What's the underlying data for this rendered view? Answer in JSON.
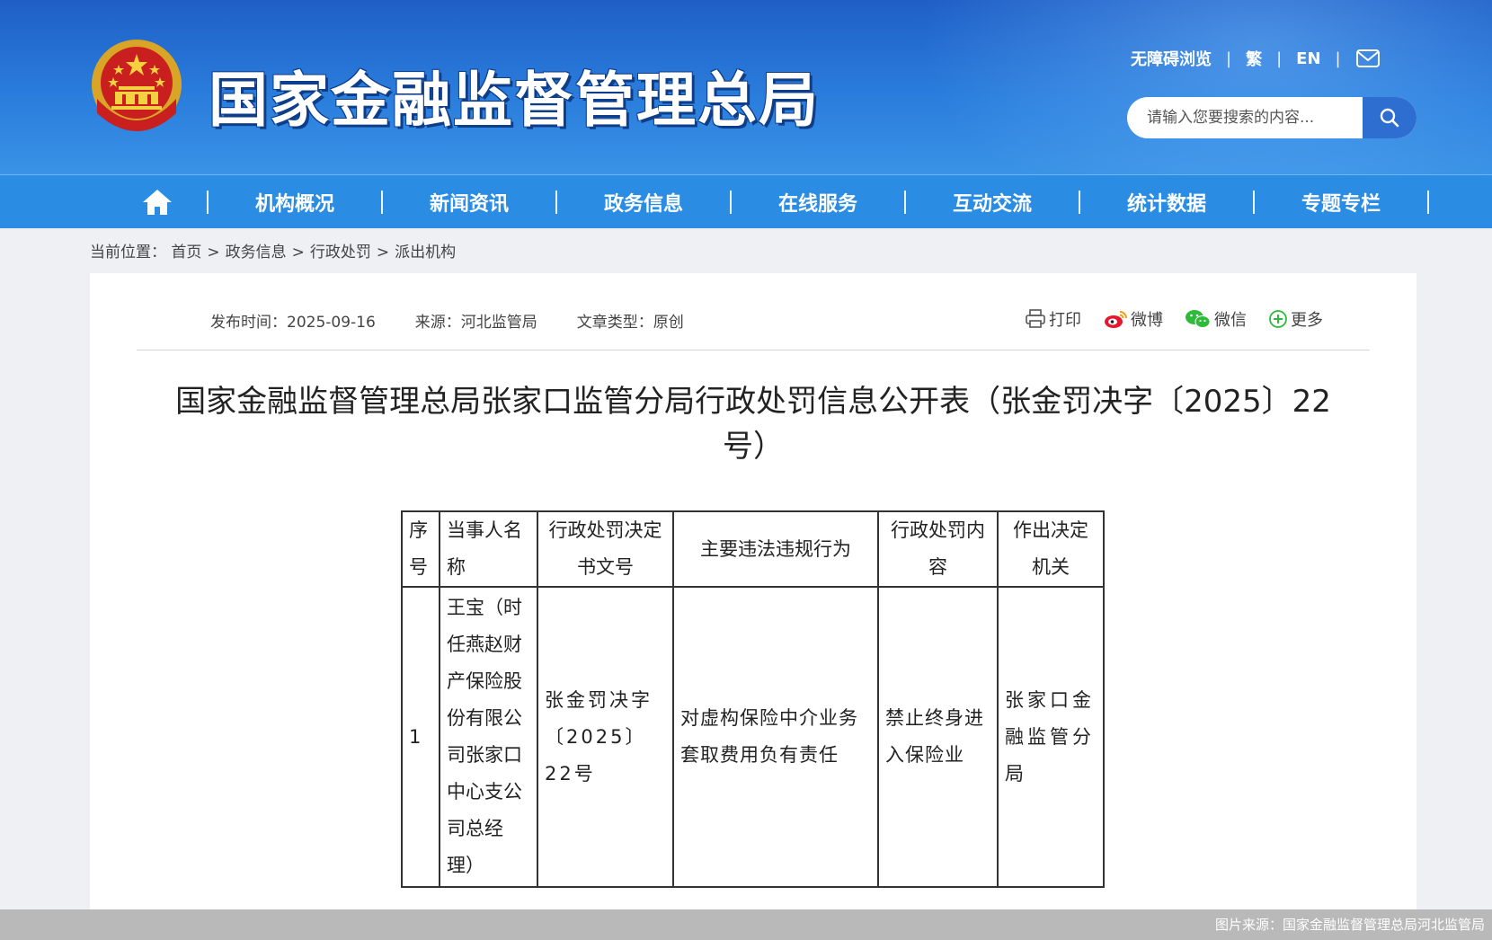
{
  "header": {
    "site_title": "国家金融监督管理总局",
    "top_links": [
      "无障碍浏览",
      "繁",
      "EN"
    ],
    "search_placeholder": "请输入您要搜索的内容..."
  },
  "nav": {
    "items": [
      "机构概况",
      "新闻资讯",
      "政务信息",
      "在线服务",
      "互动交流",
      "统计数据",
      "专题专栏"
    ]
  },
  "breadcrumb": {
    "label": "当前位置：",
    "items": [
      "首页",
      "政务信息",
      "行政处罚",
      "派出机构"
    ]
  },
  "meta": {
    "publish_time": "发布时间：2025-09-16",
    "source": "来源：河北监管局",
    "type": "文章类型：原创"
  },
  "share": {
    "print": "打印",
    "weibo": "微博",
    "wechat": "微信",
    "more": "更多"
  },
  "article": {
    "title": "国家金融监督管理总局张家口监管分局行政处罚信息公开表（张金罚决字〔2025〕22号）"
  },
  "table": {
    "headers": [
      "序号",
      "当事人名称",
      "行政处罚决定书文号",
      "主要违法违规行为",
      "行政处罚内容",
      "作出决定机关"
    ],
    "rows": [
      [
        "1",
        "王宝（时任燕赵财产保险股份有限公司张家口中心支公司总经理）",
        "张金罚决字〔2025〕22号",
        "对虚构保险中介业务套取费用负有责任",
        "禁止终身进入保险业",
        "张家口金融监管分局"
      ]
    ]
  },
  "footer": {
    "credit": "图片来源：国家金融监督管理总局河北监管局"
  }
}
